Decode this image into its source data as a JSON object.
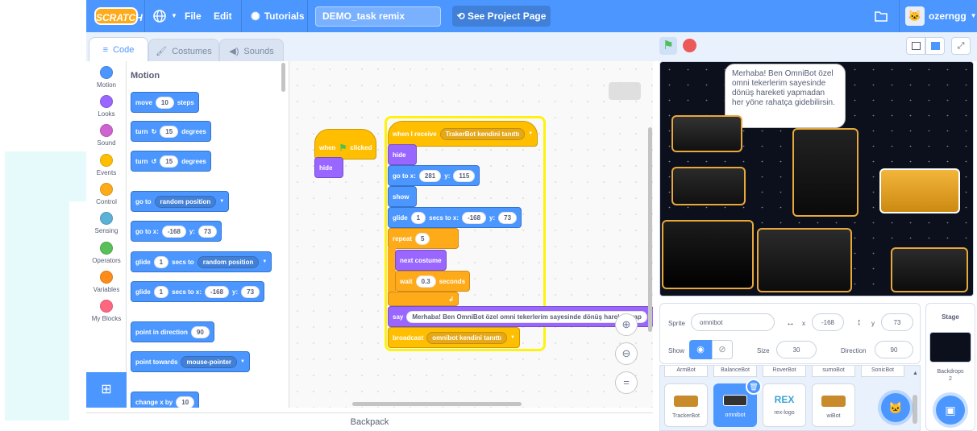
{
  "menu": {
    "logo": "SCRATCH",
    "globe_icon": "globe-icon",
    "file": "File",
    "edit": "Edit",
    "tutorials": "Tutorials",
    "project_title": "DEMO_task remix",
    "see_project": "See Project Page",
    "username": "ozerngg"
  },
  "tabs": {
    "code": "Code",
    "costumes": "Costumes",
    "sounds": "Sounds"
  },
  "categories": [
    {
      "label": "Motion",
      "color": "#4c97ff"
    },
    {
      "label": "Looks",
      "color": "#9966ff"
    },
    {
      "label": "Sound",
      "color": "#cf63cf"
    },
    {
      "label": "Events",
      "color": "#ffbf00"
    },
    {
      "label": "Control",
      "color": "#ffab19"
    },
    {
      "label": "Sensing",
      "color": "#5cb1d6"
    },
    {
      "label": "Operators",
      "color": "#59c059"
    },
    {
      "label": "Variables",
      "color": "#ff8c1a"
    },
    {
      "label": "My Blocks",
      "color": "#ff6680"
    }
  ],
  "palette": {
    "title": "Motion",
    "move": "move",
    "move_val": "10",
    "steps": "steps",
    "turn": "turn",
    "turn_r_val": "15",
    "turn_l_val": "15",
    "degrees": "degrees",
    "goto": "go to",
    "random_position": "random position",
    "goto_xy": "go to x:",
    "goto_x": "-168",
    "y_label": "y:",
    "goto_y": "73",
    "glide": "glide",
    "glide_val": "1",
    "secs_to": "secs to",
    "glide_random": "random position",
    "secs_to_x": "secs to x:",
    "glide_x": "-168",
    "glide_y": "73",
    "point_dir": "point in direction",
    "point_dir_val": "90",
    "point_towards": "point towards",
    "mouse_pointer": "mouse-pointer",
    "change_x": "change x by",
    "change_x_val": "10"
  },
  "script1": {
    "when": "when",
    "clicked": "clicked",
    "hide": "hide"
  },
  "script2": {
    "when_receive": "when I receive",
    "message": "TrakerBot kendini tanıttı",
    "hide": "hide",
    "goto": "go to x:",
    "x": "281",
    "y_label": "y:",
    "y": "115",
    "show": "show",
    "glide": "glide",
    "glide_val": "1",
    "secs_to_x": "secs to x:",
    "glide_x": "-168",
    "glide_y": "73",
    "repeat": "repeat",
    "repeat_val": "5",
    "next_costume": "next costume",
    "wait": "wait",
    "wait_val": "0.3",
    "seconds": "seconds",
    "say": "say",
    "say_text": "Merhaba! Ben OmniBot özel omni tekerlerim sayesinde dönüş hareketi yap",
    "broadcast": "broadcast",
    "broadcast_msg": "omnibot kendini tanıttı"
  },
  "backpack": "Backpack",
  "stage": {
    "speech": "Merhaba! Ben OmniBot özel omni tekerlerim sayesinde dönüş hareketi yapmadan her yöne rahatça gidebilirsin."
  },
  "sprite_info": {
    "sprite_label": "Sprite",
    "sprite_name": "omnibot",
    "x_label": "x",
    "x": "-168",
    "y_label": "y",
    "y": "73",
    "show_label": "Show",
    "size_label": "Size",
    "size": "30",
    "direction_label": "Direction",
    "direction": "90"
  },
  "sprites_row1": [
    "ArmBot",
    "BalanceBot",
    "RoverBot",
    "sumoBot",
    "SonicBot"
  ],
  "sprites_row2": [
    "TrackerBot",
    "omnibot",
    "rex-logo",
    "wiBot"
  ],
  "rex_logo_text": "REX",
  "stage_panel": {
    "title": "Stage",
    "backdrops_label": "Backdrops",
    "backdrops_count": "2"
  }
}
